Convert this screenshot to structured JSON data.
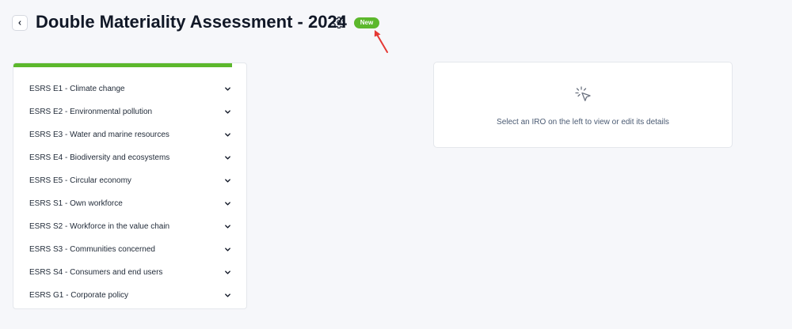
{
  "header": {
    "title": "Double Materiality Assessment - 2024",
    "badge": "New"
  },
  "icons": {
    "back": "chevron-left-icon",
    "settings": "gear-icon",
    "topic_toggle": "chevron-down-icon",
    "empty_state": "cursor-click-icon",
    "annotation": "red-arrow-icon"
  },
  "colors": {
    "accent": "#5cb82c",
    "annotation": "#e53935"
  },
  "topics": [
    {
      "label": "ESRS E1 - Climate change"
    },
    {
      "label": "ESRS E2 - Environmental pollution"
    },
    {
      "label": "ESRS E3 - Water and marine resources"
    },
    {
      "label": "ESRS E4 - Biodiversity and ecosystems"
    },
    {
      "label": "ESRS E5 - Circular economy"
    },
    {
      "label": "ESRS S1 - Own workforce"
    },
    {
      "label": "ESRS S2 - Workforce in the value chain"
    },
    {
      "label": "ESRS S3 - Communities concerned"
    },
    {
      "label": "ESRS S4 - Consumers and end users"
    },
    {
      "label": "ESRS G1 - Corporate policy"
    }
  ],
  "details": {
    "empty_message": "Select an IRO on the left to view or edit its details"
  }
}
